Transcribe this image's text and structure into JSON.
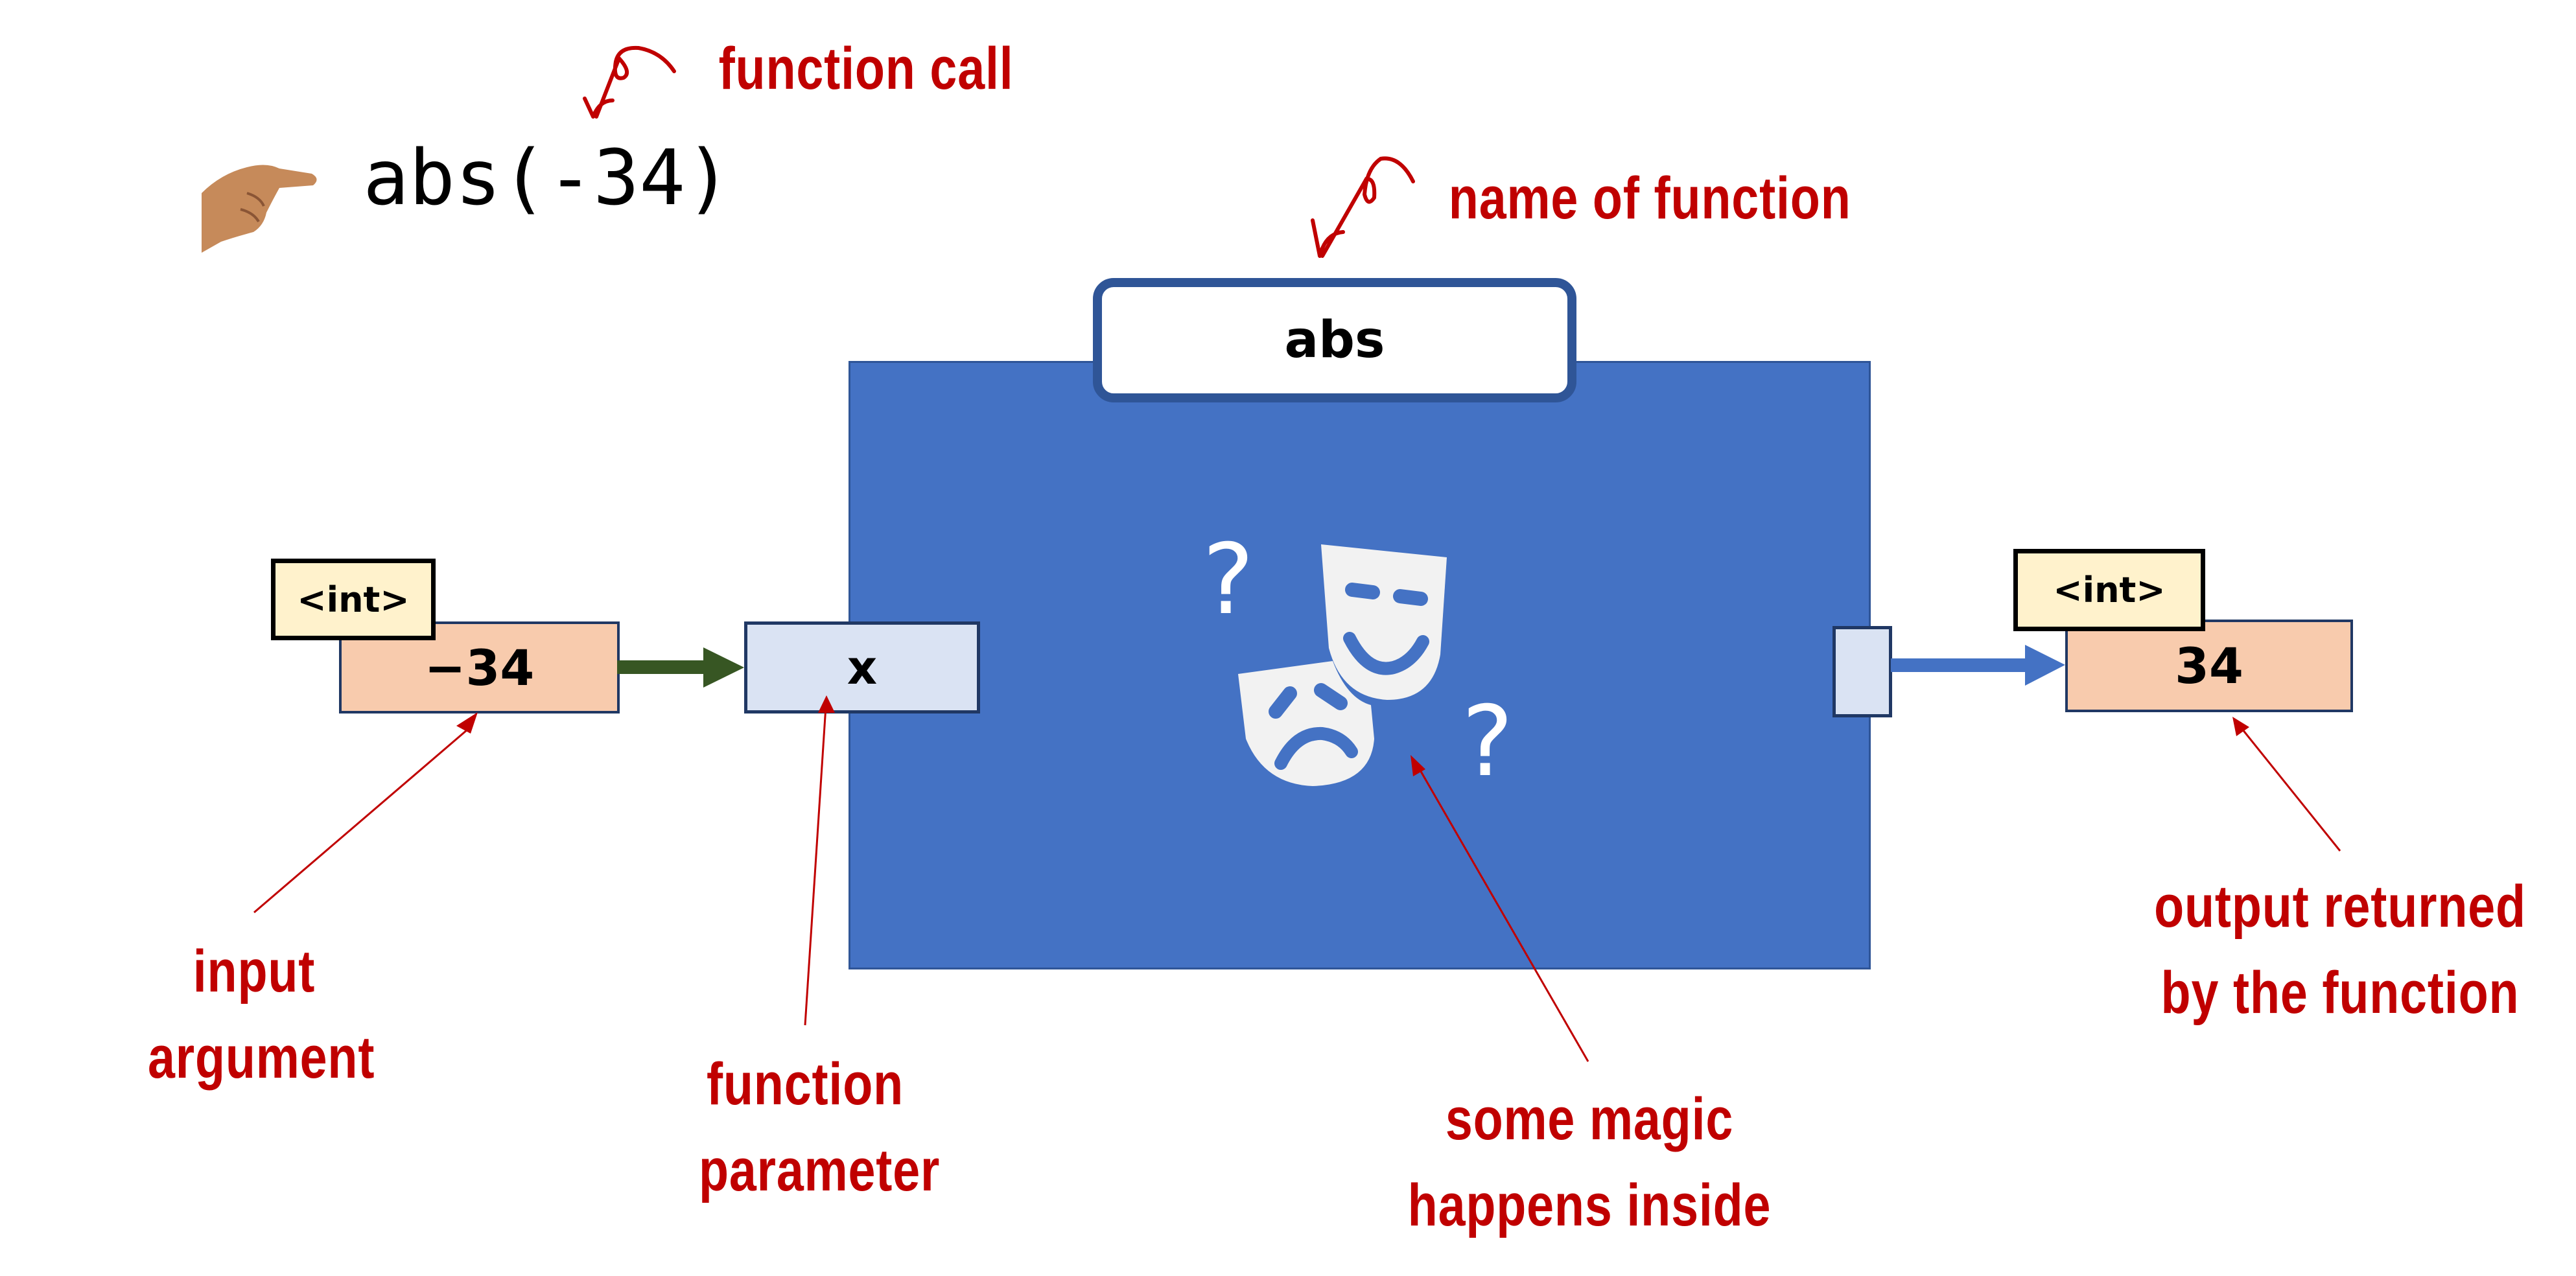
{
  "call_expression": "abs(-34)",
  "annotations": {
    "function_call": "function call",
    "name_of_function": "name of function",
    "input_argument": [
      "input",
      "argument"
    ],
    "function_parameter": [
      "function",
      "parameter"
    ],
    "magic": [
      "some magic",
      "happens inside"
    ],
    "output": [
      "output returned",
      "by the function"
    ]
  },
  "function": {
    "name": "abs",
    "parameter": "x",
    "inner_icon": "theater-masks-icon",
    "question_marks": [
      "?",
      "?"
    ]
  },
  "input": {
    "type": "<int>",
    "value": "−34"
  },
  "output": {
    "type": "<int>",
    "value": "34"
  },
  "icons": {
    "pointer": "pointing-hand-icon",
    "call_arrow": "curly-arrow-icon",
    "name_arrow": "curly-arrow-icon"
  },
  "colors": {
    "annotation": "#c00000",
    "function_body": "#4472c4",
    "function_border": "#2f5597",
    "value_fill": "#f8cbad",
    "type_fill": "#fff2cc",
    "param_fill": "#dae3f3",
    "input_arrow": "#375623",
    "output_arrow": "#4472c4"
  }
}
